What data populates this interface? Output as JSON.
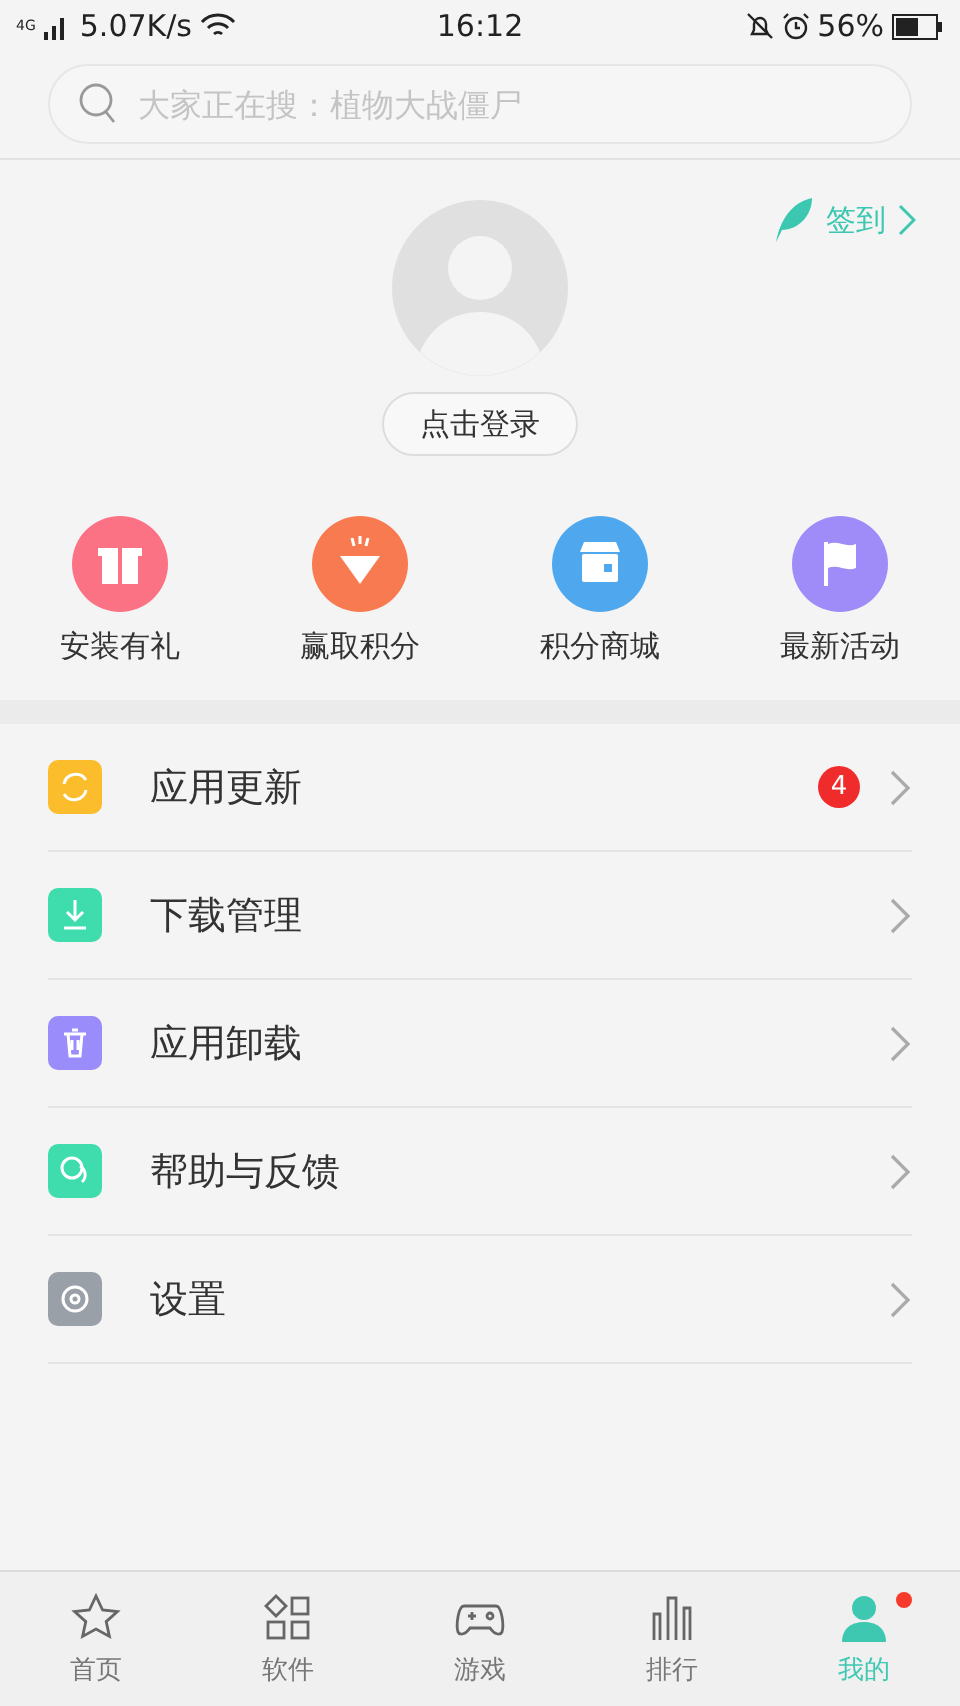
{
  "status_bar": {
    "network_type": "4G",
    "speed": "5.07K/s",
    "time": "16:12",
    "battery": "56%"
  },
  "search": {
    "placeholder": "大家正在搜：植物大战僵尸"
  },
  "profile": {
    "login_label": "点击登录",
    "checkin_label": "签到"
  },
  "quick_actions": [
    {
      "label": "安装有礼",
      "color": "#fc7285"
    },
    {
      "label": "赢取积分",
      "color": "#f87a50"
    },
    {
      "label": "积分商城",
      "color": "#4fa8ee"
    },
    {
      "label": "最新活动",
      "color": "#a08cf8"
    }
  ],
  "menu": [
    {
      "label": "应用更新",
      "color": "#fbbd2b",
      "badge": "4"
    },
    {
      "label": "下载管理",
      "color": "#3fdcae"
    },
    {
      "label": "应用卸载",
      "color": "#9a8cfa"
    },
    {
      "label": "帮助与反馈",
      "color": "#3fdcae"
    },
    {
      "label": "设置",
      "color": "#9aa0a8"
    }
  ],
  "tabs": [
    {
      "label": "首页",
      "selected": false,
      "dot": false
    },
    {
      "label": "软件",
      "selected": false,
      "dot": false
    },
    {
      "label": "游戏",
      "selected": false,
      "dot": false
    },
    {
      "label": "排行",
      "selected": false,
      "dot": false
    },
    {
      "label": "我的",
      "selected": true,
      "dot": true
    }
  ]
}
